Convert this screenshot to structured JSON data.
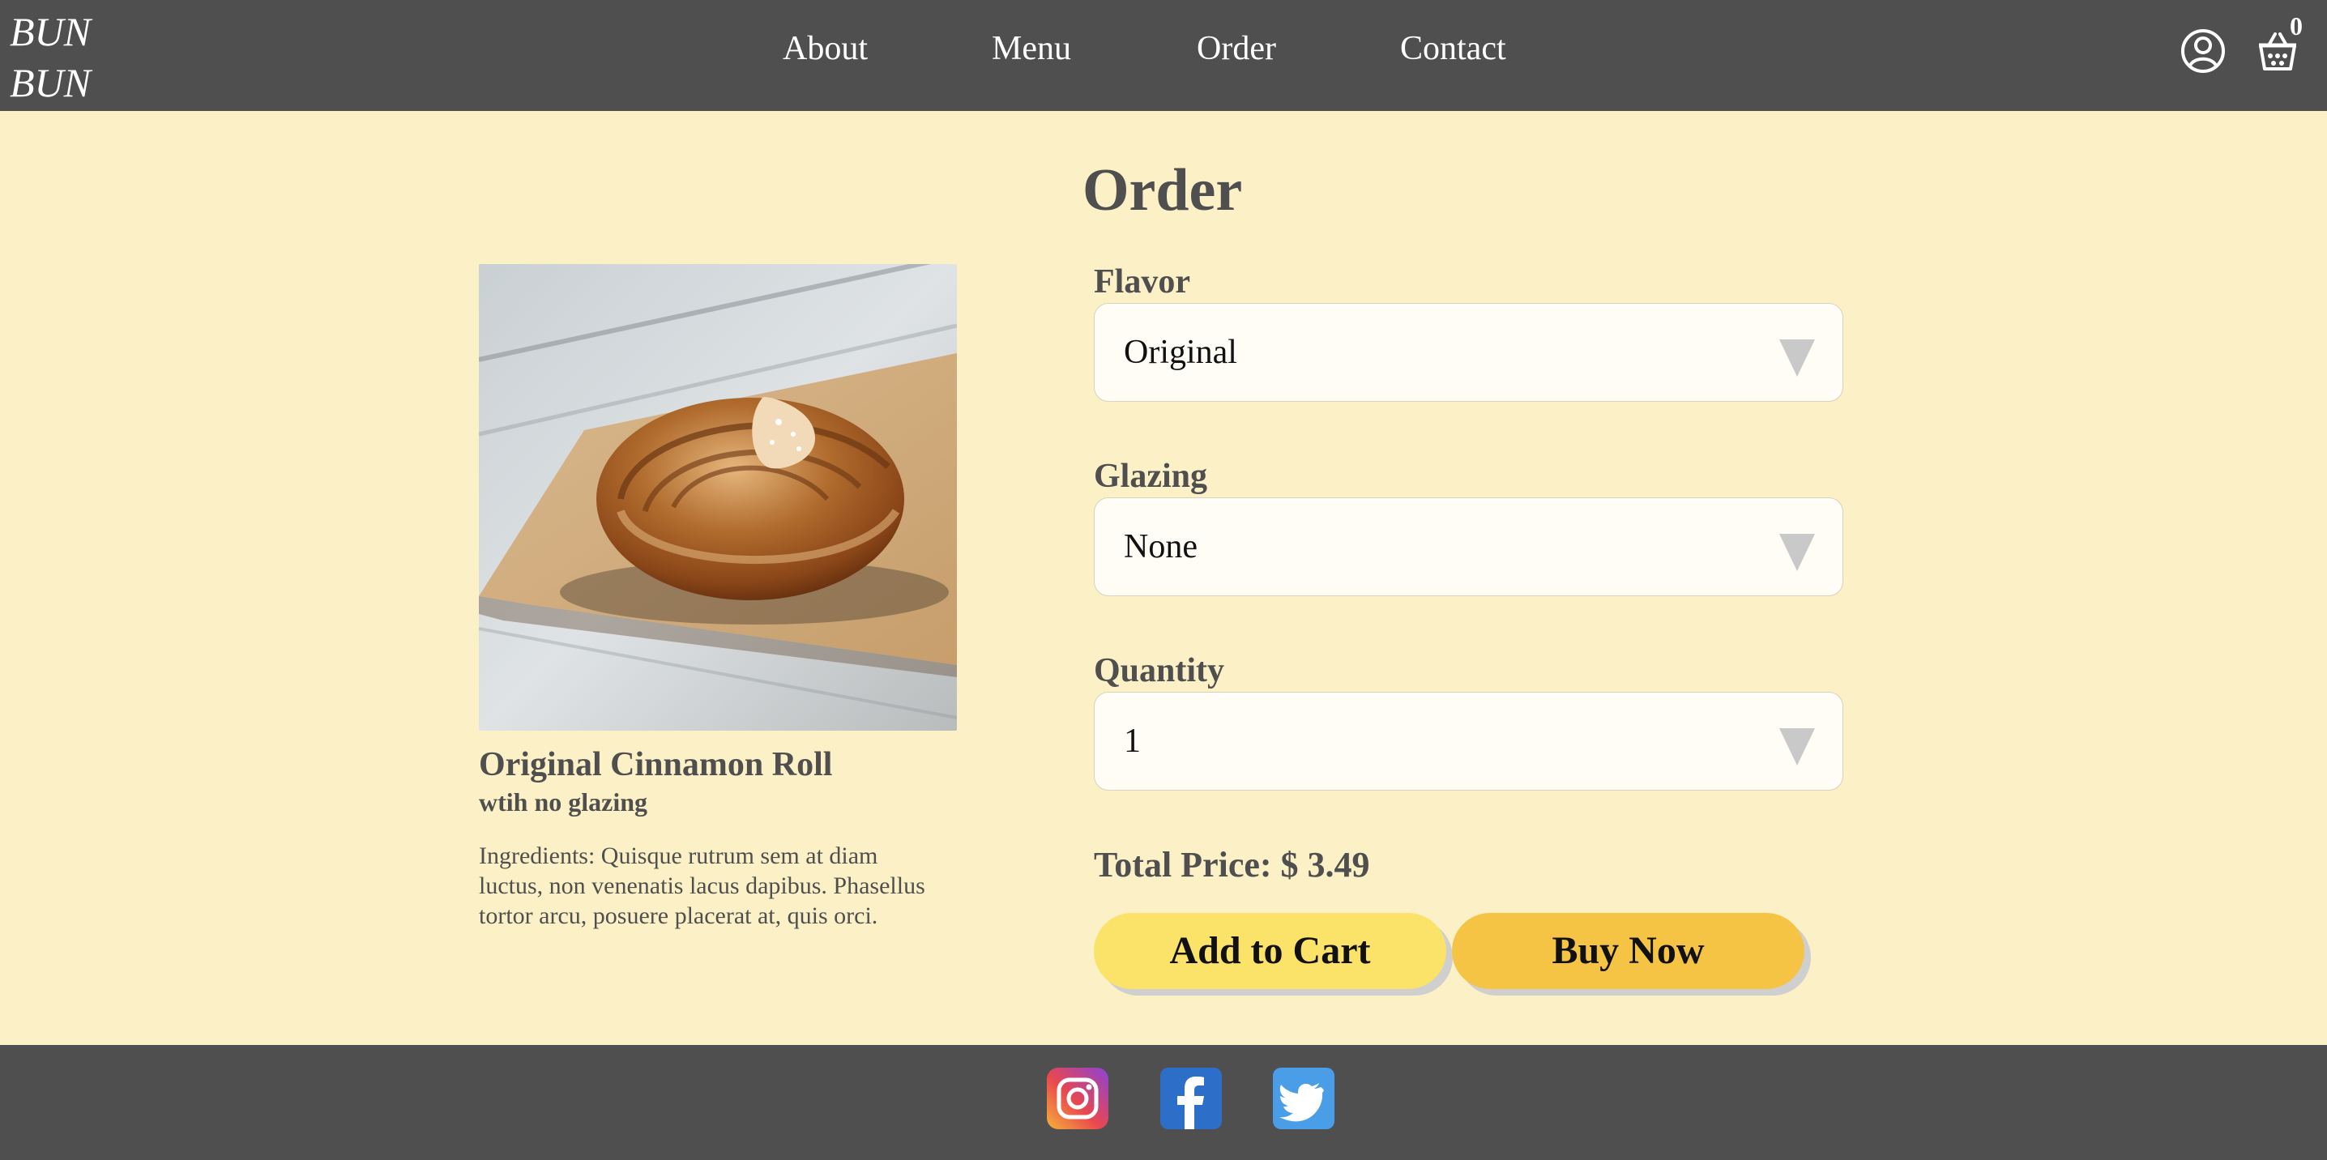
{
  "header": {
    "logo_line1": "BUN",
    "logo_line2": "BUN",
    "nav": [
      "About",
      "Menu",
      "Order",
      "Contact"
    ],
    "cart_count": "0",
    "account_icon": "account-icon",
    "cart_icon": "basket-icon"
  },
  "main": {
    "title": "Order",
    "product": {
      "name": "Original Cinnamon Roll",
      "subtitle": "wtih no glazing",
      "ingredients": "Ingredients: Quisque rutrum sem at diam luctus, non venenatis lacus dapibus. Phasellus tortor arcu, posuere placerat at, quis orci."
    },
    "fields": [
      {
        "label": "Flavor",
        "value": "Original"
      },
      {
        "label": "Glazing",
        "value": "None"
      },
      {
        "label": "Quantity",
        "value": "1"
      }
    ],
    "total_price": "Total Price: $ 3.49",
    "add_to_cart": "Add to Cart",
    "buy_now": "Buy Now"
  },
  "footer": {
    "social": [
      "instagram-icon",
      "facebook-icon",
      "twitter-icon"
    ]
  },
  "colors": {
    "background": "#fcf0c6",
    "header_footer": "#4f4f4f",
    "add_to_cart": "#fbe269",
    "buy_now": "#f6c445"
  }
}
